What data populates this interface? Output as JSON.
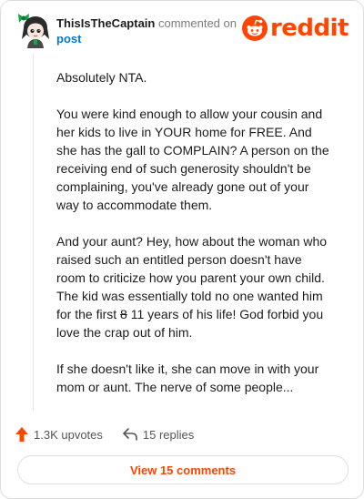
{
  "comment": {
    "username": "ThisIsTheCaptain",
    "action_text": "commented on",
    "target": "post",
    "paragraphs": {
      "p1": "Absolutely NTA.",
      "p2": "You were kind enough to allow your cousin and her kids to live in YOUR home for FREE. And she has the gall to COMPLAIN? A person on the receiving end of such generosity shouldn't be complaining, you've already gone out of your way to accommodate them.",
      "p3_before": "And your aunt? Hey, how about the woman who raised such an entitled person doesn't have room to criticize how you parent your own child. The kid was essentially told no one wanted him for the first ",
      "p3_struck": "8",
      "p3_after": " 11 years of his life! God forbid you love the crap out of him.",
      "p4": "If she doesn't like it, she can move in with your mom or aunt. The nerve of some people..."
    }
  },
  "brand": {
    "wordmark": "reddit",
    "color": "#ff4500"
  },
  "footer": {
    "upvotes_label": "1.3K upvotes",
    "replies_label": "15 replies",
    "view_comments_label": "View 15 comments"
  },
  "icons": {
    "avatar": "avatar",
    "logo": "reddit-snoo-icon",
    "upvote": "upvote-arrow-icon",
    "reply": "reply-arrow-icon"
  },
  "colors": {
    "accent": "#ff4500",
    "link": "#0079d3",
    "text": "#1c1c1c",
    "muted": "#7c7c7c"
  }
}
